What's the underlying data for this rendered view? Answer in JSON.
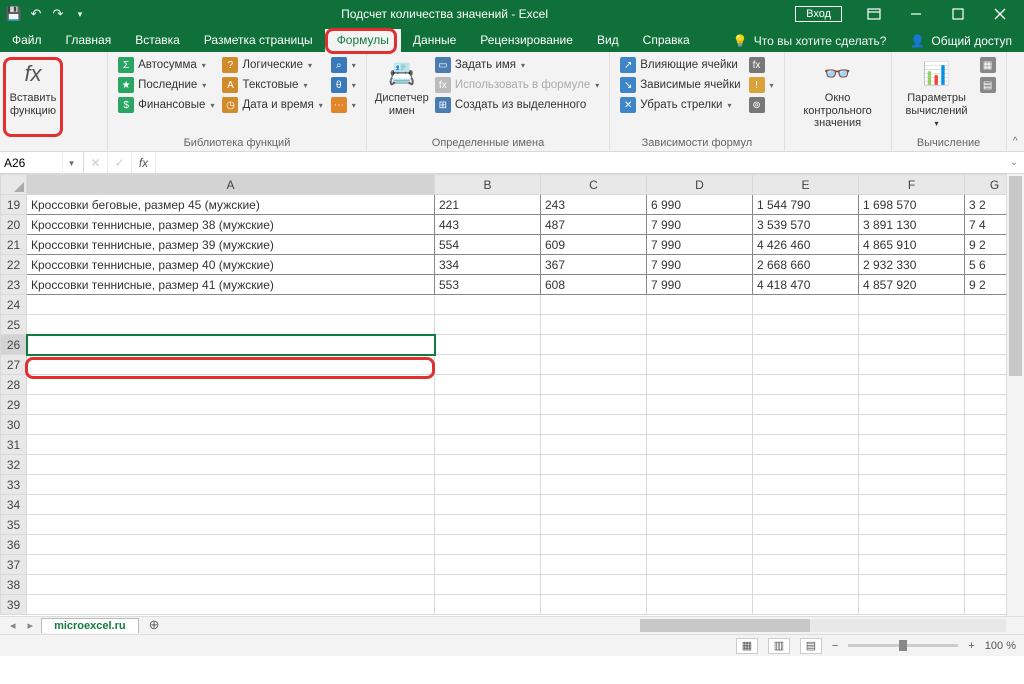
{
  "title": "Подсчет количества значений  -  Excel",
  "signin": "Вход",
  "tabs": [
    "Файл",
    "Главная",
    "Вставка",
    "Разметка страницы",
    "Формулы",
    "Данные",
    "Рецензирование",
    "Вид",
    "Справка"
  ],
  "active_tab": 4,
  "tell_me": "Что вы хотите сделать?",
  "share": "Общий доступ",
  "ribbon": {
    "insert_fn": "Вставить функцию",
    "lib": {
      "autosum": "Автосумма",
      "recent": "Последние",
      "financial": "Финансовые",
      "logical": "Логические",
      "text": "Текстовые",
      "datetime": "Дата и время",
      "label": "Библиотека функций"
    },
    "names": {
      "manager": "Диспетчер имен",
      "define": "Задать имя",
      "use": "Использовать в формуле",
      "create": "Создать из выделенного",
      "label": "Определенные имена"
    },
    "audit": {
      "precedents": "Влияющие ячейки",
      "dependents": "Зависимые ячейки",
      "remove": "Убрать стрелки",
      "label": "Зависимости формул"
    },
    "watch": {
      "btn": "Окно контрольного значения"
    },
    "calc": {
      "options": "Параметры вычислений",
      "label": "Вычисление"
    }
  },
  "namebox": "A26",
  "sheet": "microexcel.ru",
  "zoom": "100 %",
  "columns": [
    "A",
    "B",
    "C",
    "D",
    "E",
    "F",
    "G"
  ],
  "rows": [
    {
      "n": 19,
      "a": "Кроссовки беговые, размер 45 (мужские)",
      "b": "221",
      "c": "243",
      "d": "6 990",
      "e": "1 544 790",
      "f": "1 698 570",
      "g": "3 2"
    },
    {
      "n": 20,
      "a": "Кроссовки теннисные, размер 38 (мужские)",
      "b": "443",
      "c": "487",
      "d": "7 990",
      "e": "3 539 570",
      "f": "3 891 130",
      "g": "7 4"
    },
    {
      "n": 21,
      "a": "Кроссовки теннисные, размер 39 (мужские)",
      "b": "554",
      "c": "609",
      "d": "7 990",
      "e": "4 426 460",
      "f": "4 865 910",
      "g": "9 2"
    },
    {
      "n": 22,
      "a": "Кроссовки теннисные, размер 40 (мужские)",
      "b": "334",
      "c": "367",
      "d": "7 990",
      "e": "2 668 660",
      "f": "2 932 330",
      "g": "5 6"
    },
    {
      "n": 23,
      "a": "Кроссовки теннисные, размер 41 (мужские)",
      "b": "553",
      "c": "608",
      "d": "7 990",
      "e": "4 418 470",
      "f": "4 857 920",
      "g": "9 2"
    }
  ],
  "empty_rows": [
    24,
    25,
    26,
    27,
    28,
    29,
    30,
    31,
    32,
    33,
    34,
    35,
    36,
    37,
    38,
    39
  ],
  "selected_row": 26
}
